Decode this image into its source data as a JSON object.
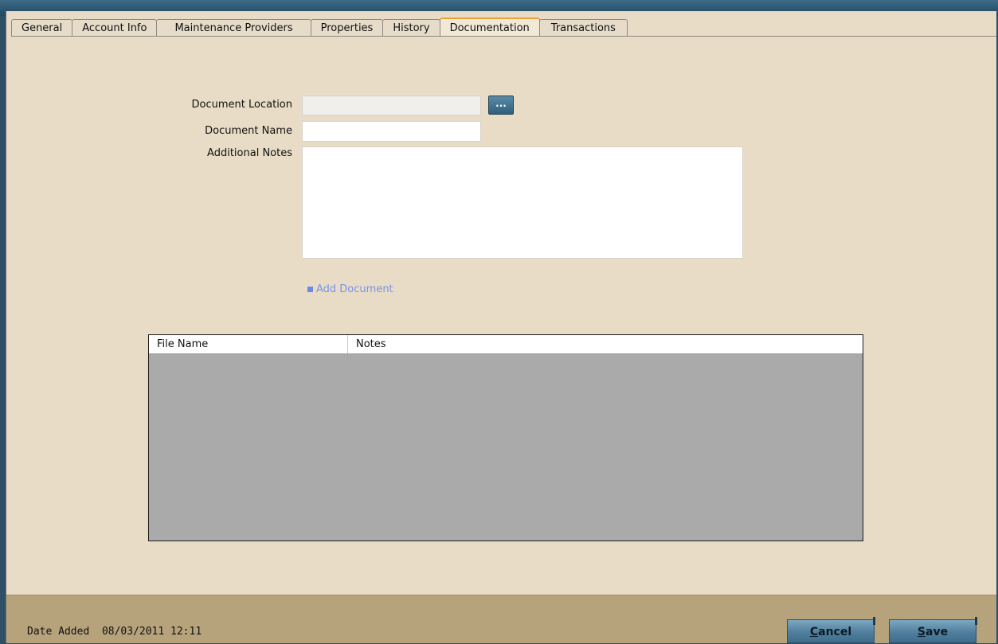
{
  "tabs": [
    {
      "label": "General",
      "active": false
    },
    {
      "label": "Account Info",
      "active": false
    },
    {
      "label": "Maintenance Providers",
      "active": false
    },
    {
      "label": "Properties",
      "active": false
    },
    {
      "label": "History",
      "active": false
    },
    {
      "label": "Documentation",
      "active": true
    },
    {
      "label": "Transactions",
      "active": false
    }
  ],
  "form": {
    "location_label": "Document Location",
    "location_value": "",
    "browse_label": "...",
    "name_label": "Document Name",
    "name_value": "",
    "notes_label": "Additional Notes",
    "notes_value": ""
  },
  "add_document_label": "Add Document",
  "grid": {
    "columns": [
      "File Name",
      "Notes"
    ],
    "rows": []
  },
  "footer": {
    "date_label": "Date Added",
    "date_value": "08/03/2011 12:11",
    "cancel_hotkey": "C",
    "cancel_rest": "ancel",
    "save_hotkey": "S",
    "save_rest": "ave"
  },
  "colors": {
    "background": "#e8dcc6",
    "footer": "#b6a37c",
    "active_tab_accent": "#e7a23a",
    "link": "#7b93e6",
    "grid_body": "#aaaaaa"
  }
}
